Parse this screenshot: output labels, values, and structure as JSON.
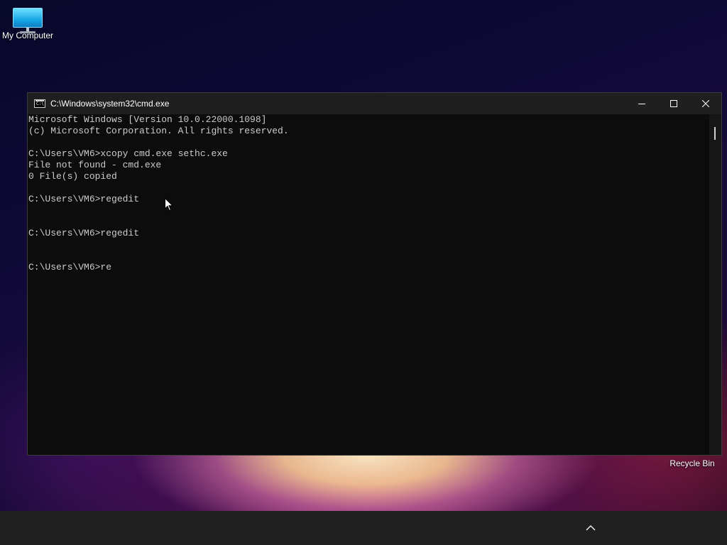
{
  "desktop": {
    "icons": [
      {
        "label": "My Computer",
        "icon": "monitor-icon"
      },
      {
        "label": "Recycle Bin",
        "icon": "recycle-bin-icon"
      }
    ]
  },
  "window": {
    "title": "C:\\Windows\\system32\\cmd.exe",
    "icon_prompt": "C:\\",
    "buttons": [
      "minimize",
      "maximize",
      "close"
    ]
  },
  "console": {
    "lines": [
      "Microsoft Windows [Version 10.0.22000.1098]",
      "(c) Microsoft Corporation. All rights reserved.",
      "",
      "C:\\Users\\VM6>xcopy cmd.exe sethc.exe",
      "File not found - cmd.exe",
      "0 File(s) copied",
      "",
      "C:\\Users\\VM6>regedit",
      "",
      "",
      "C:\\Users\\VM6>regedit",
      "",
      "",
      "C:\\Users\\VM6>re"
    ]
  },
  "taskbar": {
    "tray_icon": "chevron-up-icon"
  },
  "colors": {
    "console_bg": "#0c0c0c",
    "console_text": "#cccccc",
    "titlebar_bg": "#1f1f1f",
    "taskbar_bg": "#202020"
  }
}
